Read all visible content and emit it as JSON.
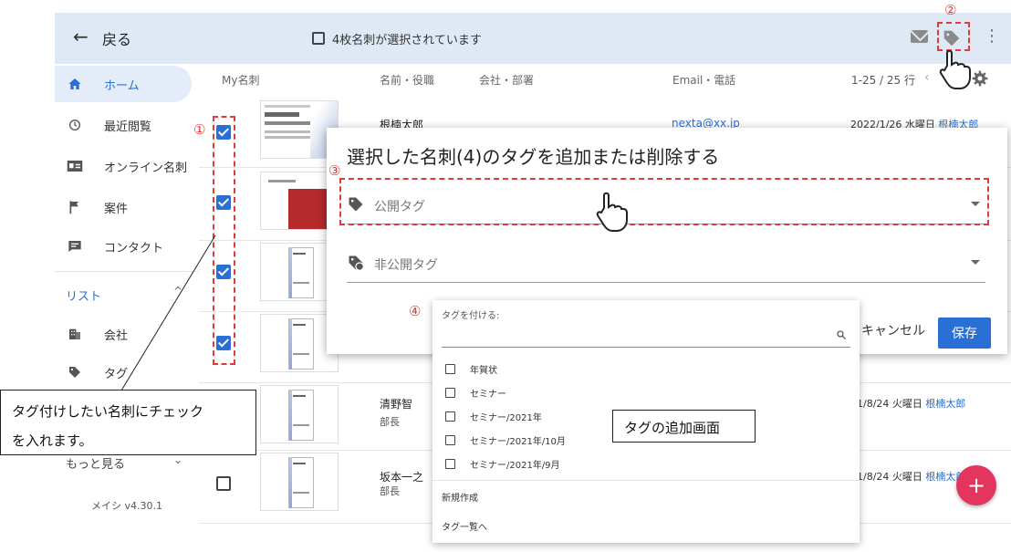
{
  "header": {
    "back_label": "戻る",
    "selection_text": "4枚名刺が選択されています"
  },
  "sidebar": {
    "items": [
      {
        "label": "ホーム",
        "icon": "home-icon"
      },
      {
        "label": "最近閲覧",
        "icon": "history-icon"
      },
      {
        "label": "オンライン名刺",
        "icon": "id-card-icon"
      },
      {
        "label": "案件",
        "icon": "flag-icon"
      },
      {
        "label": "コンタクト",
        "icon": "chat-icon"
      }
    ],
    "list_heading": "リスト",
    "list_items": [
      {
        "label": "会社",
        "icon": "building-icon"
      },
      {
        "label": "タグ",
        "icon": "tag-icon"
      }
    ],
    "more_label": "もっと見る",
    "version": "メイシ v4.30.1"
  },
  "table": {
    "columns": [
      "My名刺",
      "名前・役職",
      "会社・部署",
      "Email・電話"
    ],
    "pager": "1-25 / 25 行",
    "rows": [
      {
        "checked": true,
        "name": "根楠太郎",
        "title": "",
        "email": "nexta@xx.jp",
        "date": "2022/1/26 水曜日",
        "owner": "根楠太郎"
      },
      {
        "checked": true,
        "name": "",
        "title": "",
        "email": "",
        "date": "",
        "owner": ""
      },
      {
        "checked": true,
        "name": "",
        "title": "",
        "email": "",
        "date": "",
        "owner": ""
      },
      {
        "checked": true,
        "name": "",
        "title": "",
        "email": "",
        "date": "",
        "owner": ""
      },
      {
        "checked": false,
        "name": "清野智",
        "title": "部長",
        "email": "",
        "date": "21/8/24 火曜日",
        "owner": "根楠太郎"
      },
      {
        "checked": false,
        "name": "坂本一之",
        "title": "部長",
        "email": "",
        "date": "21/8/24 火曜日",
        "owner": "根楠太郎"
      }
    ]
  },
  "dialog": {
    "title": "選択した名刺(4)のタグを追加または削除する",
    "public_tag_label": "公開タグ",
    "private_tag_label": "非公開タグ",
    "cancel_label": "キャンセル",
    "save_label": "保存"
  },
  "tag_menu": {
    "heading": "タグを付ける:",
    "search_placeholder": "",
    "options": [
      "年賀状",
      "セミナー",
      "セミナー/2021年",
      "セミナー/2021年/10月",
      "セミナー/2021年/9月"
    ],
    "create_label": "新規作成",
    "list_link": "タグ一覧へ"
  },
  "annotations": {
    "step1": "①",
    "step2": "②",
    "step3": "③",
    "step4": "④",
    "callout_line1": "タグ付けしたい名刺にチェック",
    "callout_line2": "を入れます。",
    "tag_screen_label": "タグの追加画面"
  },
  "colors": {
    "accent": "#2a6fd6",
    "annotation_red": "#e03a3a",
    "fab": "#e2365f",
    "topbar": "#dfe9f5"
  }
}
